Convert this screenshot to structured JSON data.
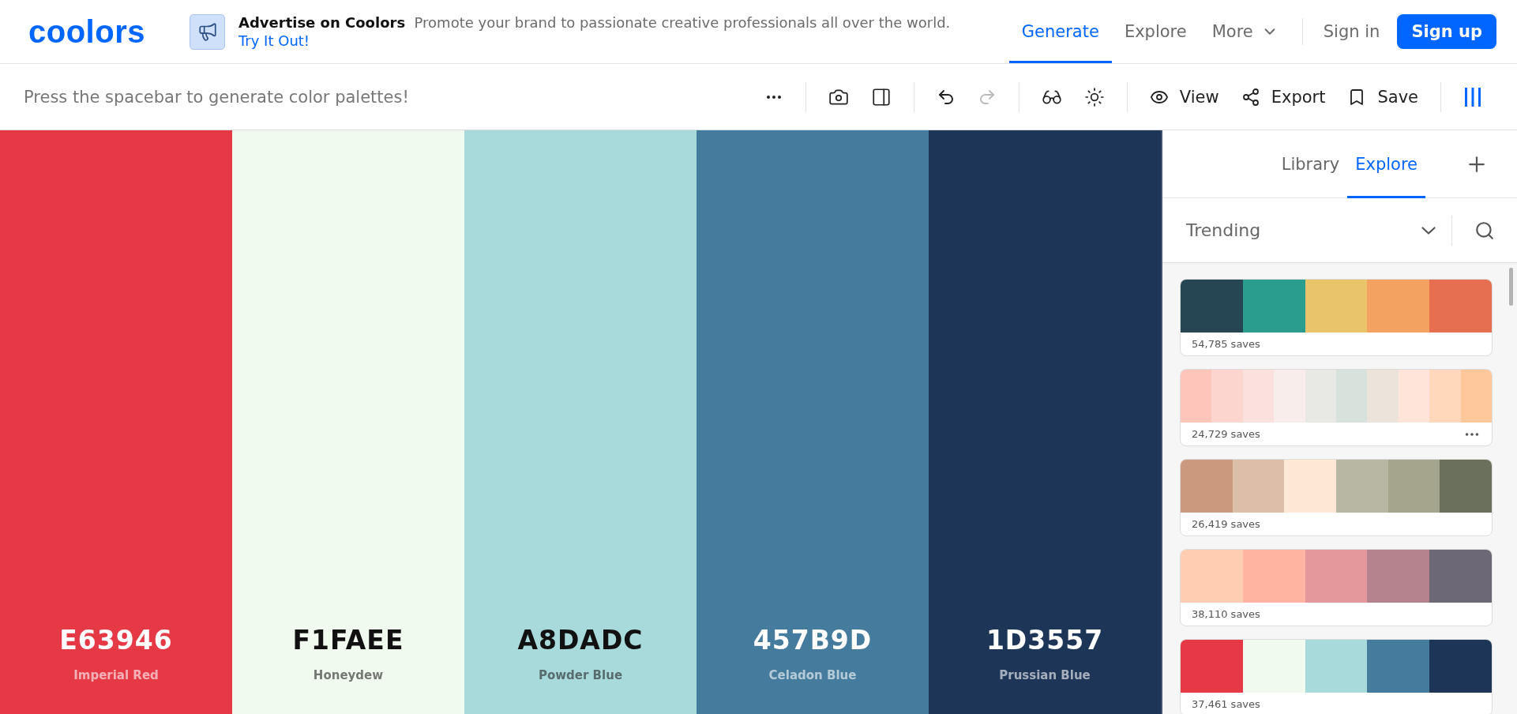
{
  "header": {
    "logo": "coolors",
    "ad": {
      "title": "Advertise on Coolors",
      "text": "Promote your brand to passionate creative professionals all over the world.",
      "link": "Try It Out!"
    },
    "nav": [
      {
        "label": "Generate",
        "selected": true,
        "dropdown": false
      },
      {
        "label": "Explore",
        "selected": false,
        "dropdown": false
      },
      {
        "label": "More",
        "selected": false,
        "dropdown": true
      }
    ],
    "sign_in": "Sign in",
    "sign_up": "Sign up"
  },
  "toolbar": {
    "hint": "Press the spacebar to generate color palettes!",
    "redo": {
      "disabled": true
    },
    "view": "View",
    "export": "Export",
    "save": "Save"
  },
  "palette": [
    {
      "hex": "E63946",
      "name": "Imperial Red",
      "color": "#e63946"
    },
    {
      "hex": "F1FAEE",
      "name": "Honeydew",
      "color": "#f1faee"
    },
    {
      "hex": "A8DADC",
      "name": "Powder Blue",
      "color": "#a8dadc"
    },
    {
      "hex": "457B9D",
      "name": "Celadon Blue",
      "color": "#457b9d"
    },
    {
      "hex": "1D3557",
      "name": "Prussian Blue",
      "color": "#1d3557"
    }
  ],
  "sidebar": {
    "tabs": [
      {
        "label": "Library",
        "selected": false
      },
      {
        "label": "Explore",
        "selected": true
      }
    ],
    "filter": "Trending",
    "palettes": [
      {
        "saves": "54,785 saves",
        "menu_visible": false,
        "swatches": [
          {
            "color": "#264653"
          },
          {
            "color": "#2a9d8f"
          },
          {
            "color": "#e9c46a"
          },
          {
            "color": "#f4a261"
          },
          {
            "color": "#e76f51"
          }
        ]
      },
      {
        "saves": "24,729 saves",
        "menu_visible": true,
        "swatches": [
          {
            "color": "#fec5bb"
          },
          {
            "color": "#fcd5ce"
          },
          {
            "color": "#fae1dd"
          },
          {
            "color": "#f8edeb"
          },
          {
            "color": "#e8e8e4"
          },
          {
            "color": "#d8e2dc"
          },
          {
            "color": "#ece4db"
          },
          {
            "color": "#ffe5d9"
          },
          {
            "color": "#ffd7ba"
          },
          {
            "color": "#fec89a"
          }
        ]
      },
      {
        "saves": "26,419 saves",
        "menu_visible": false,
        "swatches": [
          {
            "color": "#cb997e"
          },
          {
            "color": "#ddbea9"
          },
          {
            "color": "#ffe8d6"
          },
          {
            "color": "#b7b7a4"
          },
          {
            "color": "#a5a58d"
          },
          {
            "color": "#6b705c"
          }
        ]
      },
      {
        "saves": "38,110 saves",
        "menu_visible": false,
        "swatches": [
          {
            "color": "#ffcdb2"
          },
          {
            "color": "#ffb4a2"
          },
          {
            "color": "#e5989b"
          },
          {
            "color": "#b5838d"
          },
          {
            "color": "#6d6875"
          }
        ]
      },
      {
        "saves": "37,461 saves",
        "menu_visible": false,
        "swatches": [
          {
            "color": "#e63946"
          },
          {
            "color": "#f1faee"
          },
          {
            "color": "#a8dadc"
          },
          {
            "color": "#457b9d"
          },
          {
            "color": "#1d3557"
          }
        ]
      }
    ]
  }
}
